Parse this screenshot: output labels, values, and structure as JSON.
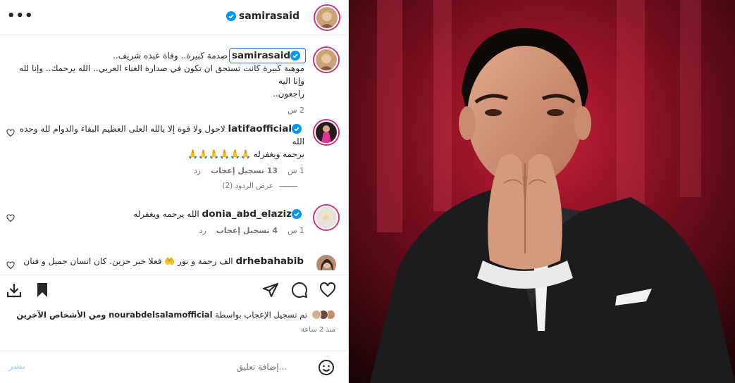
{
  "header": {
    "username": "samirasaid",
    "more_icon": "more-horizontal-icon"
  },
  "caption": {
    "username": "samirasaid",
    "text_line1": "صدمة كبيرة.. وفاة عبده شريف..",
    "text_line2": "موهبة كبيرة كانت تستحق ان تكون في صدارة الغناء العربي.. الله يرحمك.. وإنا لله وإنا اليه",
    "text_line3": "راجعون..",
    "time": "2 س"
  },
  "comments": [
    {
      "username": "latifaofficial",
      "text_line1": "لاحول ولا قوة إلا بالله العلى العظيم البقاء والدوام لله وحده الله",
      "text_line2": "يرحمه ويغفرله 🙏🙏🙏🙏🙏🙏",
      "time": "1 س",
      "likes": "13 تسجيل إعجاب",
      "reply": "رد",
      "view_replies": "عرض الردود (2)"
    },
    {
      "username": "donia_abd_elaziz",
      "text": "الله يرحمه ويغفرله",
      "time": "1 س",
      "likes": "4 تسجيل إعجاب",
      "reply": "رد"
    },
    {
      "username": "drhebahabib",
      "text": "الف رحمة و نور 🤲 فعلا خبر حزين. كان انسان جميل و فنان"
    }
  ],
  "likes_summary": {
    "prefix": "تم تسجيل الإعجاب بواسطة",
    "user": "nourabdelsalamofficial",
    "suffix": "ومن الأشخاص الآخرين",
    "time": "منذ 2 ساعة"
  },
  "add_comment": {
    "placeholder": "إضافة تعليق...",
    "post_label": "نشر"
  },
  "colors": {
    "verified": "#0095f6",
    "story_ring": "#d62976",
    "post_disabled": "#b3dbff"
  }
}
